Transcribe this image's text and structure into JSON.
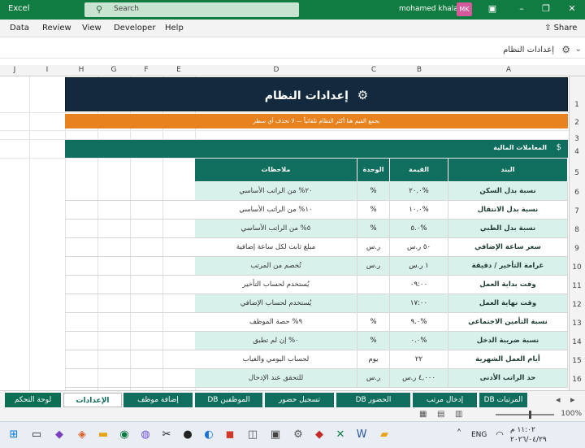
{
  "titlebar": {
    "app_name": "Excel",
    "search_placeholder": "Search",
    "user_name": "mohamed khalaf",
    "user_initials": "MK"
  },
  "menu": {
    "items": [
      "Data",
      "Review",
      "View",
      "Developer",
      "Help"
    ],
    "share_label": "Share"
  },
  "formula_bar": {
    "value": "إعدادات النظام"
  },
  "columns": [
    "J",
    "I",
    "H",
    "G",
    "F",
    "E",
    "D",
    "C",
    "B",
    "A"
  ],
  "rows": [
    "1",
    "2",
    "3",
    "4",
    "5",
    "6",
    "7",
    "8",
    "9",
    "10",
    "11",
    "12",
    "13",
    "14",
    "15",
    "16"
  ],
  "sheet": {
    "banner_title": "إعدادات النظام",
    "notice": "يجمع القيم هنا أكثر النظام تلقائياً — لا تحذف أي سطر",
    "section_title": "المعاملات المالية",
    "headers": {
      "item": "البند",
      "value": "القيمة",
      "unit": "الوحدة",
      "notes": "ملاحظات"
    },
    "rows": [
      {
        "item": "نسبة بدل السكن",
        "value": "%٢٠.٠",
        "unit": "%",
        "notes": "٢٠% من الراتب الأساسي"
      },
      {
        "item": "نسبة بدل الانتقال",
        "value": "%١٠.٠",
        "unit": "%",
        "notes": "١٠% من الراتب الأساسي"
      },
      {
        "item": "نسبة بدل الطبي",
        "value": "%٥.٠",
        "unit": "%",
        "notes": "٥% من الراتب الأساسي"
      },
      {
        "item": "سعر ساعة الإضافي",
        "value": "٥٠ ر.س",
        "unit": "ر.س",
        "notes": "مبلغ ثابت لكل ساعة إضافية"
      },
      {
        "item": "غرامة التأخير / دقيقة",
        "value": "١ ر.س",
        "unit": "ر.س",
        "notes": "تُخصم من المرتب"
      },
      {
        "item": "وقت بداية العمل",
        "value": "٠٩:٠٠",
        "unit": "",
        "notes": "يُستخدم لحساب التأخير"
      },
      {
        "item": "وقت نهاية العمل",
        "value": "١٧:٠٠",
        "unit": "",
        "notes": "يُستخدم لحساب الإضافي"
      },
      {
        "item": "نسبة التأمين الاجتماعي",
        "value": "%٩.٠",
        "unit": "%",
        "notes": "٩% حصة الموظف"
      },
      {
        "item": "نسبة ضريبة الدخل",
        "value": "%٠.٠",
        "unit": "%",
        "notes": "٠% إن لم تطبق"
      },
      {
        "item": "أيام العمل الشهرية",
        "value": "٢٢",
        "unit": "يوم",
        "notes": "لحساب اليومي والغياب"
      },
      {
        "item": "حد الراتب الأدنى",
        "value": "٤,٠٠٠ ر.س",
        "unit": "ر.س",
        "notes": "للتحقق عند الإدخال"
      }
    ]
  },
  "tabs": [
    "المرتبات DB",
    "إدخال مرتب",
    "الحضور DB",
    "تسجيل حضور",
    "الموظفين DB",
    "إضافة موظف",
    "الإعدادات",
    "لوحة التحكم"
  ],
  "active_tab": "الإعدادات",
  "status": {
    "zoom": "100%"
  },
  "taskbar": {
    "lang": "ENG",
    "time": "١١:٠٢ م",
    "date": "٢٠٢٦/٠٤/٢٩"
  },
  "colors": {
    "title_green": "#107c41",
    "banner_navy": "#13293d",
    "notice_orange": "#e8821e",
    "teal": "#0f6e5d",
    "row_tint": "#d8f1eb"
  }
}
